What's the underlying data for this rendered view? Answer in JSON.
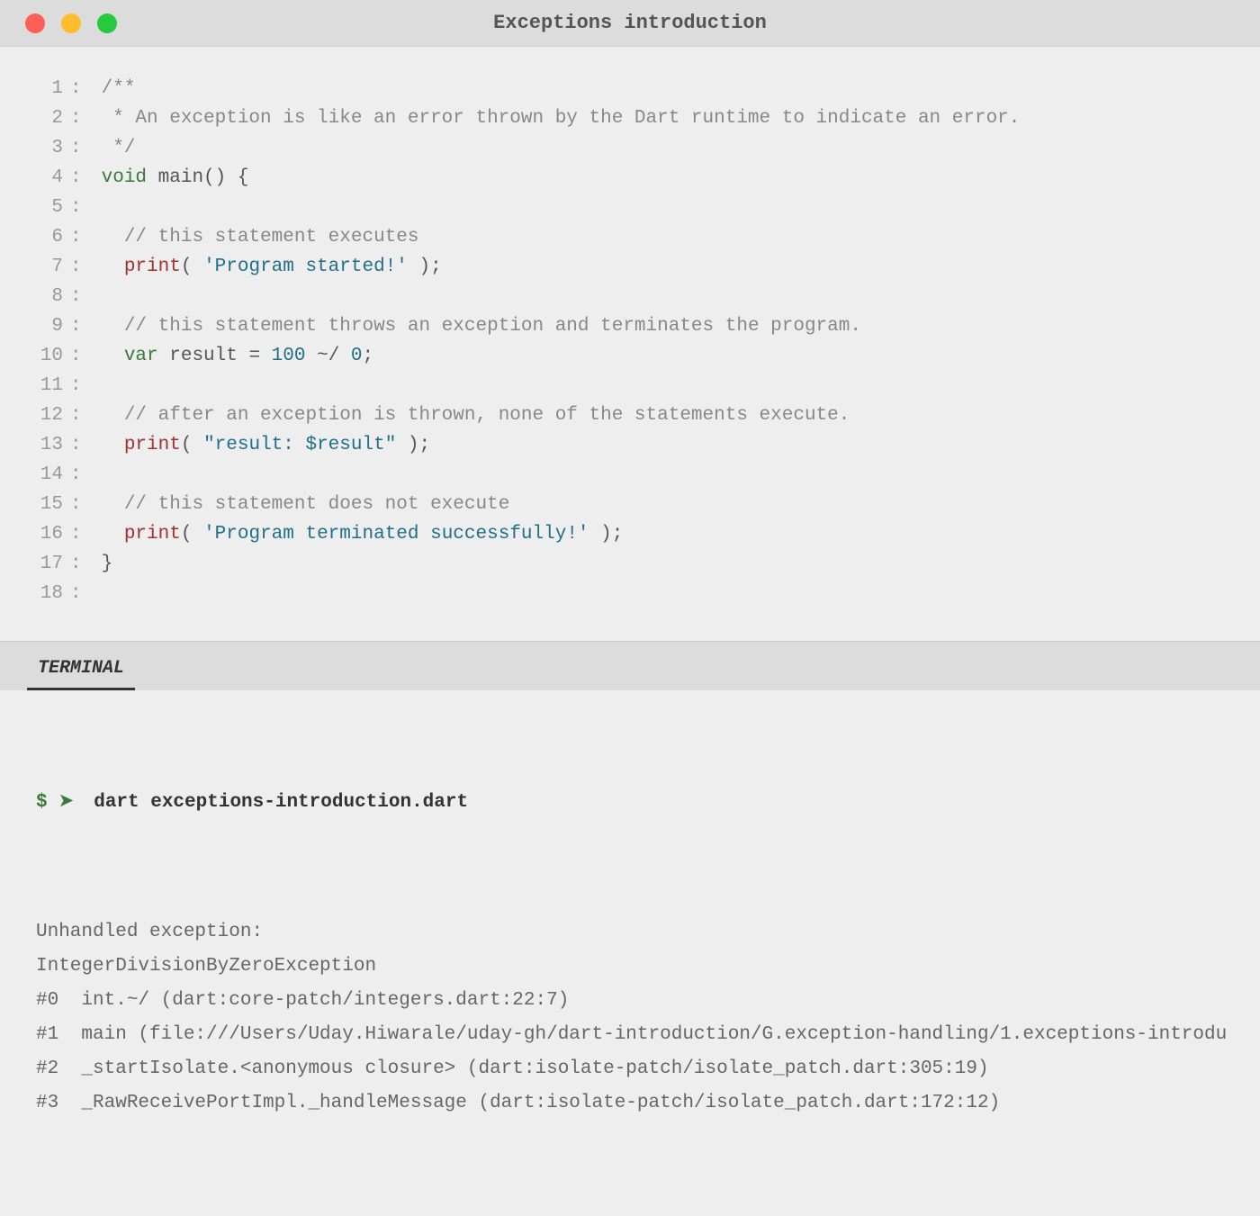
{
  "window": {
    "title": "Exceptions introduction"
  },
  "code": {
    "lines": [
      {
        "n": "1",
        "tokens": [
          {
            "cls": "c-comment",
            "t": "/**"
          }
        ]
      },
      {
        "n": "2",
        "tokens": [
          {
            "cls": "c-comment",
            "t": " * An exception is like an error thrown by the Dart runtime to indicate an error."
          }
        ]
      },
      {
        "n": "3",
        "tokens": [
          {
            "cls": "c-comment",
            "t": " */"
          }
        ]
      },
      {
        "n": "4",
        "tokens": [
          {
            "cls": "c-keyword",
            "t": "void"
          },
          {
            "cls": "",
            "t": " main() {"
          }
        ]
      },
      {
        "n": "5",
        "tokens": []
      },
      {
        "n": "6",
        "tokens": [
          {
            "cls": "",
            "t": "  "
          },
          {
            "cls": "c-comment",
            "t": "// this statement executes"
          }
        ]
      },
      {
        "n": "7",
        "tokens": [
          {
            "cls": "",
            "t": "  "
          },
          {
            "cls": "c-fn",
            "t": "print"
          },
          {
            "cls": "",
            "t": "( "
          },
          {
            "cls": "c-string",
            "t": "'Program started!'"
          },
          {
            "cls": "",
            "t": " );"
          }
        ]
      },
      {
        "n": "8",
        "tokens": []
      },
      {
        "n": "9",
        "tokens": [
          {
            "cls": "",
            "t": "  "
          },
          {
            "cls": "c-comment",
            "t": "// this statement throws an exception and terminates the program."
          }
        ]
      },
      {
        "n": "10",
        "tokens": [
          {
            "cls": "",
            "t": "  "
          },
          {
            "cls": "c-keyword",
            "t": "var"
          },
          {
            "cls": "",
            "t": " result = "
          },
          {
            "cls": "c-number",
            "t": "100"
          },
          {
            "cls": "",
            "t": " ~/ "
          },
          {
            "cls": "c-number",
            "t": "0"
          },
          {
            "cls": "",
            "t": ";"
          }
        ]
      },
      {
        "n": "11",
        "tokens": []
      },
      {
        "n": "12",
        "tokens": [
          {
            "cls": "",
            "t": "  "
          },
          {
            "cls": "c-comment",
            "t": "// after an exception is thrown, none of the statements execute."
          }
        ]
      },
      {
        "n": "13",
        "tokens": [
          {
            "cls": "",
            "t": "  "
          },
          {
            "cls": "c-fn",
            "t": "print"
          },
          {
            "cls": "",
            "t": "( "
          },
          {
            "cls": "c-string",
            "t": "\"result: $result\""
          },
          {
            "cls": "",
            "t": " );"
          }
        ]
      },
      {
        "n": "14",
        "tokens": []
      },
      {
        "n": "15",
        "tokens": [
          {
            "cls": "",
            "t": "  "
          },
          {
            "cls": "c-comment",
            "t": "// this statement does not execute"
          }
        ]
      },
      {
        "n": "16",
        "tokens": [
          {
            "cls": "",
            "t": "  "
          },
          {
            "cls": "c-fn",
            "t": "print"
          },
          {
            "cls": "",
            "t": "( "
          },
          {
            "cls": "c-string",
            "t": "'Program terminated successfully!'"
          },
          {
            "cls": "",
            "t": " );"
          }
        ]
      },
      {
        "n": "17",
        "tokens": [
          {
            "cls": "",
            "t": "}"
          }
        ]
      },
      {
        "n": "18",
        "tokens": []
      }
    ]
  },
  "terminal": {
    "tab_label": "TERMINAL",
    "prompt_symbol": "$",
    "prompt_arrow": "➤",
    "command": "dart exceptions-introduction.dart",
    "output": [
      "Unhandled exception:",
      "IntegerDivisionByZeroException",
      "#0  int.~/ (dart:core-patch/integers.dart:22:7)",
      "#1  main (file:///Users/Uday.Hiwarale/uday-gh/dart-introduction/G.exception-handling/1.exceptions-introdu",
      "#2  _startIsolate.<anonymous closure> (dart:isolate-patch/isolate_patch.dart:305:19)",
      "#3  _RawReceivePortImpl._handleMessage (dart:isolate-patch/isolate_patch.dart:172:12)"
    ]
  }
}
